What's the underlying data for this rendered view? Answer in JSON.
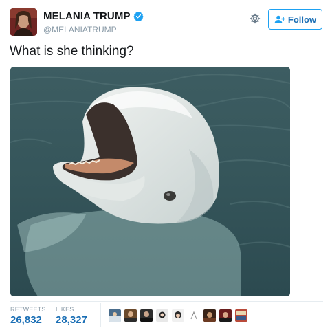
{
  "tweet": {
    "display_name": "MELANIA TRUMP",
    "handle": "@MELANIATRUMP",
    "text": "What is she thinking?",
    "follow_label": "Follow"
  },
  "stats": {
    "retweets_label": "RETWEETS",
    "retweets_value": "26,832",
    "likes_label": "LIKES",
    "likes_value": "28,327"
  },
  "icons": [
    "verified-badge-icon",
    "gear-icon",
    "follow-person-plus-icon"
  ],
  "liker_avatar_count": 10,
  "colors": {
    "accent_blue": "#1da1f2",
    "link_blue": "#1b6fb5",
    "muted_gray": "#8899a6"
  }
}
